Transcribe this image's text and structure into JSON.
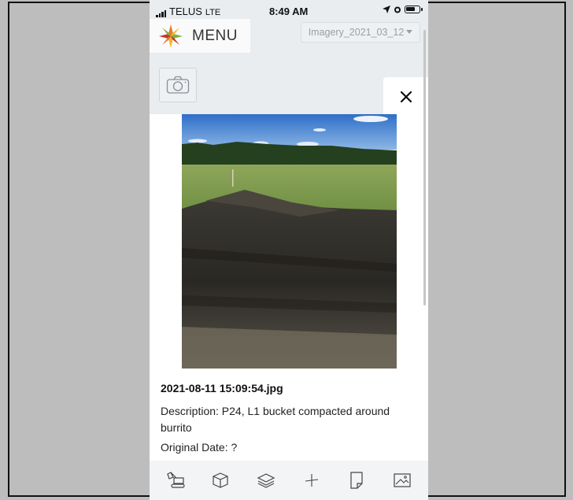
{
  "status_bar": {
    "carrier": "TELUS",
    "network": "LTE",
    "time": "8:49 AM"
  },
  "header": {
    "menu_label": "MENU",
    "imagery_select": "Imagery_2021_03_12"
  },
  "popup": {
    "filename": "2021-08-11 15:09:54.jpg",
    "description": "Description: P24, L1 bucket compacted around burrito",
    "original_date": "Original Date: ?"
  },
  "icons": {
    "camera": "camera-icon",
    "close": "close-icon",
    "toolbar": [
      "excavator-icon",
      "box-icon",
      "layers-icon",
      "crosshair-icon",
      "note-icon",
      "image-icon"
    ]
  },
  "colors": {
    "logo_orange": "#e8792b",
    "logo_green": "#7fb13c",
    "logo_yellow": "#f2b632",
    "logo_red": "#c8352f"
  }
}
